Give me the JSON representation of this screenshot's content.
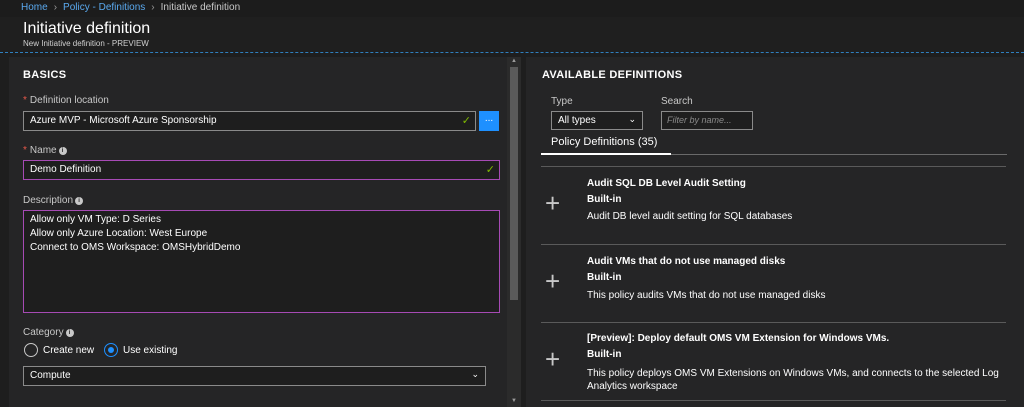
{
  "breadcrumb": {
    "home": "Home",
    "policy": "Policy - Definitions",
    "current": "Initiative definition"
  },
  "header": {
    "title": "Initiative definition",
    "subtitle": "New Initiative definition - PREVIEW"
  },
  "basics": {
    "title": "BASICS",
    "location_label": "Definition location",
    "location_value": "Azure MVP - Microsoft Azure Sponsorship",
    "ellipsis": "...",
    "name_label": "Name",
    "name_value": "Demo Definition",
    "description_label": "Description",
    "description_lines": [
      "Allow only VM Type: D Series",
      "Allow only Azure Location: West Europe",
      "Connect to OMS Workspace: OMSHybridDemo"
    ],
    "category_label": "Category",
    "radio_create": "Create new",
    "radio_existing": "Use existing",
    "category_value": "Compute"
  },
  "available": {
    "title": "AVAILABLE DEFINITIONS",
    "type_label": "Type",
    "type_value": "All types",
    "search_label": "Search",
    "search_placeholder": "Filter by name...",
    "tab_label": "Policy Definitions (35)",
    "policies": [
      {
        "name": "Audit SQL DB Level Audit Setting",
        "type": "Built-in",
        "desc": "Audit DB level audit setting for SQL databases"
      },
      {
        "name": "Audit VMs that do not use managed disks",
        "type": "Built-in",
        "desc": "This policy audits VMs that do not use managed disks"
      },
      {
        "name": "[Preview]: Deploy default OMS VM Extension for Windows VMs.",
        "type": "Built-in",
        "desc": "This policy deploys OMS VM Extensions on Windows VMs, and connects to the selected Log Analytics workspace"
      }
    ]
  },
  "icons": {
    "check": "checkmark-icon",
    "info": "info-icon",
    "plus": "plus-icon",
    "chevron": "chevron-down-icon"
  },
  "colors": {
    "accent": "#1e90ff",
    "required": "#e8594a",
    "valid": "#7fba00",
    "focus_border": "#a64ab4",
    "link": "#5aa9ef"
  }
}
